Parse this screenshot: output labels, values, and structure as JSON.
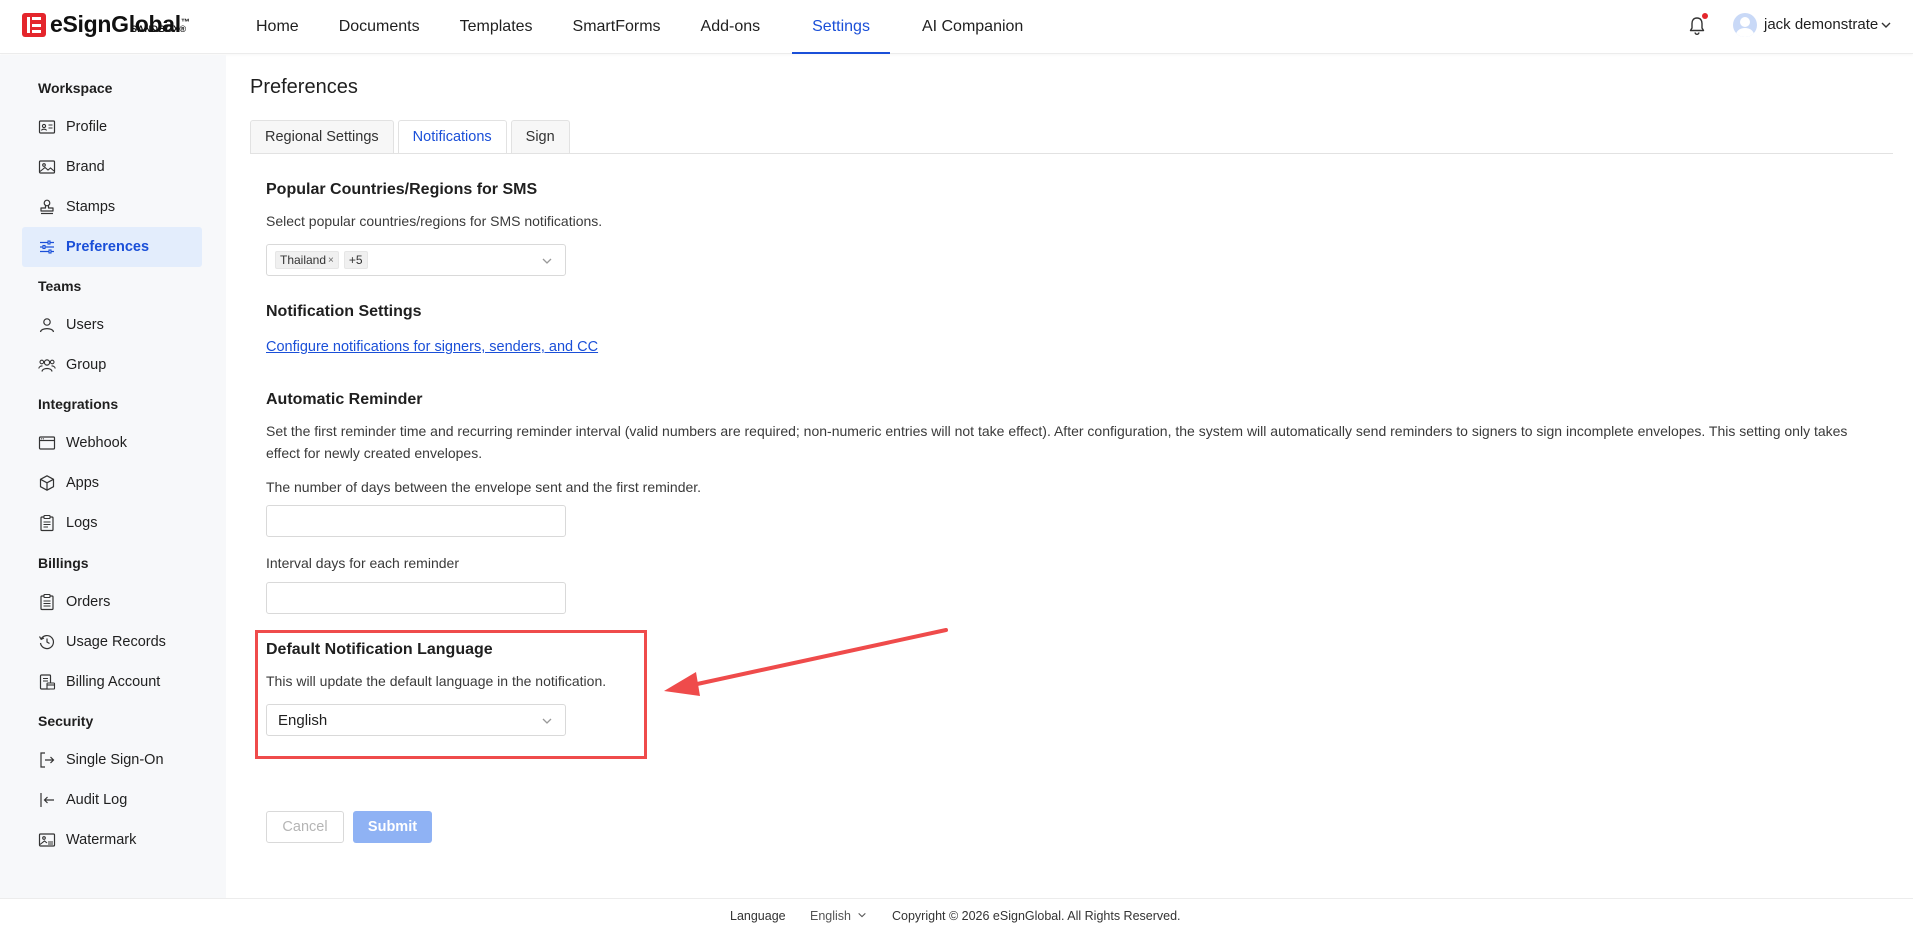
{
  "brand": {
    "name": "eSignGlobal",
    "tm": "™",
    "badge": "SANDBOX®"
  },
  "nav": {
    "items": [
      "Home",
      "Documents",
      "Templates",
      "SmartForms",
      "Add-ons",
      "Settings",
      "AI Companion"
    ],
    "active": "Settings"
  },
  "user": {
    "name": "jack demonstrate"
  },
  "sidebar": {
    "groups": {
      "workspace": "Workspace",
      "teams": "Teams",
      "integrations": "Integrations",
      "billings": "Billings",
      "security": "Security"
    },
    "items": {
      "profile": "Profile",
      "brand": "Brand",
      "stamps": "Stamps",
      "preferences": "Preferences",
      "users": "Users",
      "group": "Group",
      "webhook": "Webhook",
      "apps": "Apps",
      "logs": "Logs",
      "orders": "Orders",
      "usage_records": "Usage Records",
      "billing_account": "Billing Account",
      "sso": "Single Sign-On",
      "audit_log": "Audit Log",
      "watermark": "Watermark"
    },
    "active": "Preferences"
  },
  "page": {
    "title": "Preferences",
    "tabs": [
      "Regional Settings",
      "Notifications",
      "Sign"
    ],
    "active_tab": "Notifications"
  },
  "sms": {
    "title": "Popular Countries/Regions for SMS",
    "desc": "Select popular countries/regions for SMS notifications.",
    "tag": "Thailand",
    "more": "+5"
  },
  "notification_settings": {
    "title": "Notification Settings",
    "link": "Configure notifications for signers, senders, and CC"
  },
  "reminder": {
    "title": "Automatic Reminder",
    "desc": "Set the first reminder time and recurring reminder interval (valid numbers are required; non-numeric entries will not take effect). After configuration, the system will automatically send reminders to signers to sign incomplete envelopes. This setting only takes effect for newly created envelopes.",
    "first_label": "The number of days between the envelope sent and the first reminder.",
    "first_value": "",
    "interval_label": "Interval days for each reminder",
    "interval_value": ""
  },
  "language": {
    "title": "Default Notification Language",
    "desc": "This will update the default language in the notification.",
    "value": "English"
  },
  "actions": {
    "cancel": "Cancel",
    "submit": "Submit"
  },
  "footer": {
    "language_label": "Language",
    "language_value": "English",
    "copyright": "Copyright © 2026 eSignGlobal. All Rights Reserved."
  },
  "colors": {
    "accent": "#1a4fd8",
    "brand_red": "#e4262c",
    "annotation": "#ef4b4b",
    "submit_disabled": "#8fb2f4"
  }
}
